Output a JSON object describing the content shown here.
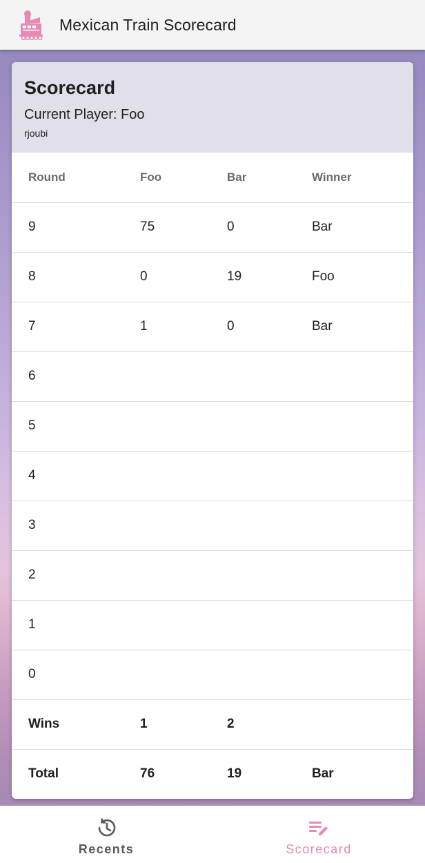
{
  "app": {
    "title": "Mexican Train Scorecard",
    "logo_icon": "train-icon",
    "accent_color": "#e889b5"
  },
  "card": {
    "title": "Scorecard",
    "current_player": "Current Player: Foo",
    "user": "rjoubi"
  },
  "table": {
    "headers": [
      "Round",
      "Foo",
      "Bar",
      "Winner"
    ],
    "rows": [
      [
        "9",
        "75",
        "0",
        "Bar"
      ],
      [
        "8",
        "0",
        "19",
        "Foo"
      ],
      [
        "7",
        "1",
        "0",
        "Bar"
      ],
      [
        "6",
        "",
        "",
        ""
      ],
      [
        "5",
        "",
        "",
        ""
      ],
      [
        "4",
        "",
        "",
        ""
      ],
      [
        "3",
        "",
        "",
        ""
      ],
      [
        "2",
        "",
        "",
        ""
      ],
      [
        "1",
        "",
        "",
        ""
      ],
      [
        "0",
        "",
        "",
        ""
      ]
    ],
    "wins": [
      "Wins",
      "1",
      "2",
      ""
    ],
    "total": [
      "Total",
      "76",
      "19",
      "Bar"
    ]
  },
  "nav": {
    "items": [
      {
        "label": "Recents",
        "icon": "history-icon",
        "active": false
      },
      {
        "label": "Scorecard",
        "icon": "edit-list-icon",
        "active": true
      }
    ]
  }
}
